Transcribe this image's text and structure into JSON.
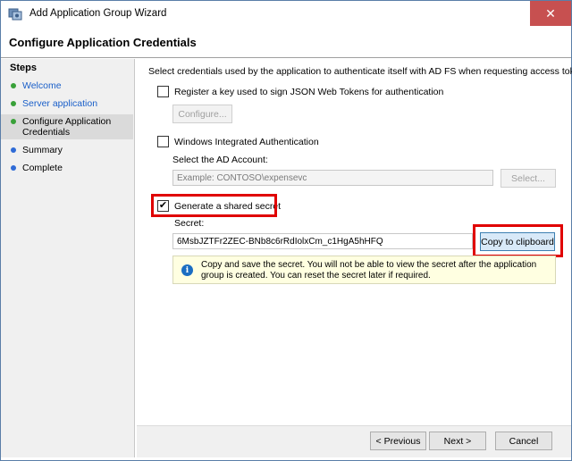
{
  "window": {
    "title": "Add Application Group Wizard",
    "close_glyph": "✕"
  },
  "header": {
    "title": "Configure Application Credentials"
  },
  "steps": {
    "title": "Steps",
    "items": [
      {
        "label": "Welcome",
        "state": "done"
      },
      {
        "label": "Server application",
        "state": "done"
      },
      {
        "label": "Configure Application Credentials",
        "state": "current"
      },
      {
        "label": "Summary",
        "state": "future"
      },
      {
        "label": "Complete",
        "state": "future"
      }
    ]
  },
  "main": {
    "intro": "Select credentials used by the application to authenticate itself with AD FS when requesting access tokens.",
    "register_key": {
      "label": "Register a key used to sign JSON Web Tokens for authentication",
      "checked": false,
      "configure_button": "Configure..."
    },
    "windows_auth": {
      "label": "Windows Integrated Authentication",
      "checked": false,
      "account_label": "Select the AD Account:",
      "account_placeholder": "Example: CONTOSO\\expensevc",
      "select_button": "Select..."
    },
    "shared_secret": {
      "label": "Generate a shared secret",
      "checked": true,
      "check_glyph": "✔",
      "secret_label": "Secret:",
      "secret_value": "6MsbJZTFr2ZEC-BNb8c6rRdIolxCm_c1HgA5hHFQ",
      "copy_button": "Copy to clipboard"
    },
    "info": {
      "icon": "info-icon",
      "text": "Copy and save the secret.  You will not be able to view the secret after the application group is created.  You can reset the secret later if required."
    }
  },
  "footer": {
    "previous_button": "< Previous",
    "next_button": "Next >",
    "cancel_button": "Cancel"
  },
  "colors": {
    "highlight": "#e00000",
    "info_background": "#ffffe1",
    "close_button": "#c75050"
  }
}
